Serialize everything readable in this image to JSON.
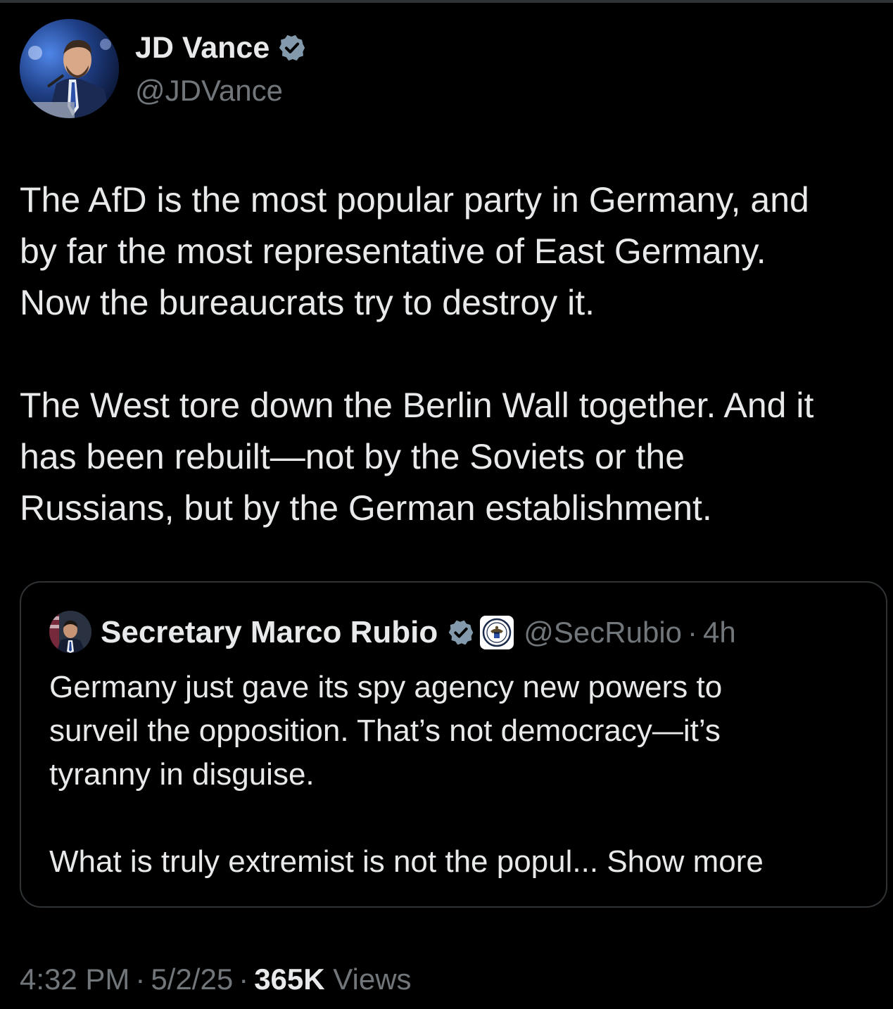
{
  "tweet": {
    "author_name": "JD Vance",
    "author_handle": "@JDVance",
    "paragraph1": [
      "The AfD is the most popular party in Germany, and",
      "by far the most representative of East Germany.",
      "Now the bureaucrats try to destroy it."
    ],
    "paragraph2": [
      "The West tore down the Berlin Wall together. And it",
      "has been rebuilt—not by the Soviets or the",
      "Russians, but by the German establishment."
    ]
  },
  "quoted_tweet": {
    "author_name": "Secretary Marco Rubio",
    "author_handle": "@SecRubio",
    "separator": "·",
    "time": "4h",
    "paragraph1": [
      "Germany just gave its spy agency new powers to",
      "surveil the opposition.  That’s not democracy—it’s",
      "tyranny in disguise."
    ],
    "paragraph2_text": "What is truly extremist is not the popul...",
    "show_more": "Show more"
  },
  "meta": {
    "time": "4:32 PM",
    "date": "5/2/25",
    "separator": "·",
    "views_count": "365K",
    "views_label": "Views"
  },
  "colors": {
    "background": "#000000",
    "text_primary": "#e7e9ea",
    "text_secondary": "#71767b",
    "border": "#2f3336",
    "verified_badge": "#829aab"
  },
  "icons": {
    "verified": "verified-badge-icon",
    "gov_seal": "government-seal-icon"
  }
}
